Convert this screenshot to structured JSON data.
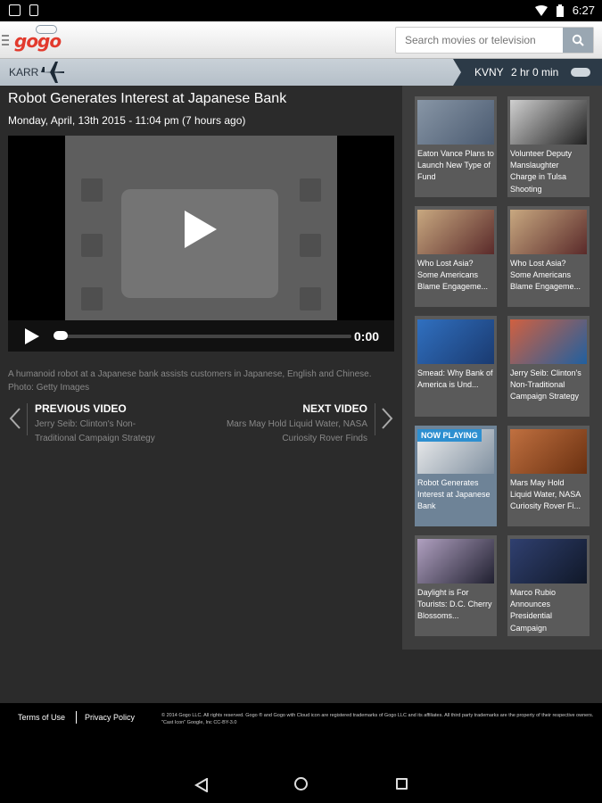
{
  "status_bar": {
    "time": "6:27"
  },
  "header": {
    "logo_text": "gogo",
    "search": {
      "placeholder": "Search movies or television",
      "value": ""
    }
  },
  "flight": {
    "origin": "KARR",
    "destination": "KVNY",
    "remaining": "2 hr 0 min"
  },
  "video": {
    "title": "Robot Generates Interest at Japanese Bank",
    "date": "Monday, April, 13th 2015 - 11:04 pm (7 hours ago)",
    "time_display": "0:00",
    "progress": 0,
    "caption": "A humanoid robot at a Japanese bank assists customers in Japanese, English and Chinese. Photo: Getty Images"
  },
  "navigation": {
    "prev_label": "PREVIOUS VIDEO",
    "prev_title": "Jerry Seib: Clinton's Non-Traditional Campaign Strategy",
    "next_label": "NEXT VIDEO",
    "next_title": "Mars May Hold Liquid Water, NASA Curiosity Rover Finds"
  },
  "playlist": [
    {
      "text": "Eaton Vance Plans to Launch New Type of Fund",
      "colors": [
        "#8896a6",
        "#4a5a70"
      ]
    },
    {
      "text": "Volunteer Deputy Manslaughter Charge in Tulsa Shooting",
      "colors": [
        "#d0d0d0",
        "#202020"
      ]
    },
    {
      "text": "Who Lost Asia? Some Americans Blame Engageme...",
      "colors": [
        "#c8a880",
        "#5a2a2a"
      ]
    },
    {
      "text": "Who Lost Asia? Some Americans Blame Engageme...",
      "colors": [
        "#c8a880",
        "#5a2a2a"
      ]
    },
    {
      "text": "Smead: Why Bank of America is Und...",
      "colors": [
        "#3070c0",
        "#1a3a70"
      ]
    },
    {
      "text": "Jerry Seib: Clinton's Non-Traditional Campaign Strategy",
      "colors": [
        "#d06040",
        "#2060a0"
      ]
    },
    {
      "text": "Robot Generates Interest at Japanese Bank",
      "colors": [
        "#f0f0f0",
        "#8090a0"
      ],
      "now_playing": "NOW PLAYING"
    },
    {
      "text": "Mars May Hold Liquid Water, NASA Curiosity Rover Fi...",
      "colors": [
        "#c07040",
        "#6a3010"
      ]
    },
    {
      "text": "Daylight is For Tourists: D.C. Cherry Blossoms...",
      "colors": [
        "#b0a0c0",
        "#202030"
      ]
    },
    {
      "text": "Marco Rubio Announces Presidential Campaign",
      "colors": [
        "#304070",
        "#101828"
      ]
    }
  ],
  "footer": {
    "terms": "Terms of Use",
    "privacy": "Privacy Policy",
    "copyright": "© 2014 Gogo LLC. All rights reserved. Gogo ® and Gogo with Cloud icon are registered trademarks of Gogo LLC and its affiliates. All third party trademarks are the property of their respective owners. \"Cast Icon\" Google, Inc CC-BY-3.0"
  }
}
